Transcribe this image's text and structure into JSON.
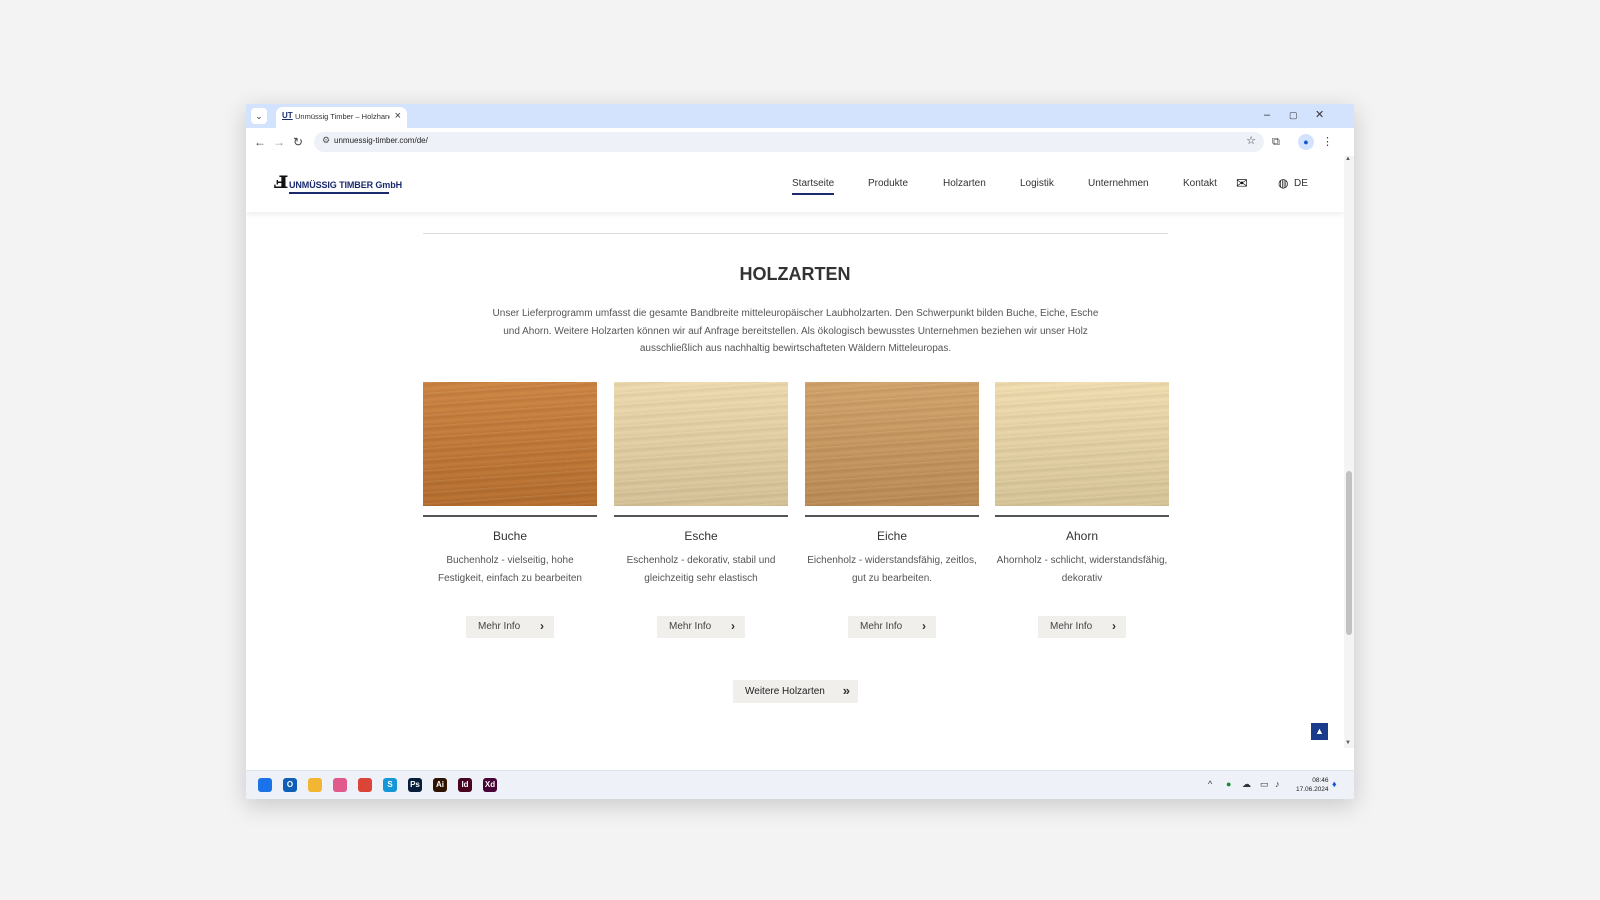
{
  "browser": {
    "tab_title": "Unmüssig Timber – Holzhandel",
    "tab_favicon": "UT",
    "url": "unmuessig-timber.com/de/",
    "tab_dropdown_icon": "chevron-down-icon",
    "window_controls": [
      "–",
      "▢",
      "✕"
    ]
  },
  "site": {
    "logo_text": "UNMÜSSIG TIMBER GmbH",
    "nav": [
      {
        "label": "Startseite",
        "active": true
      },
      {
        "label": "Produkte",
        "active": false
      },
      {
        "label": "Holzarten",
        "active": false
      },
      {
        "label": "Logistik",
        "active": false
      },
      {
        "label": "Unternehmen",
        "active": false
      },
      {
        "label": "Kontakt",
        "active": false
      }
    ],
    "language": "DE"
  },
  "section": {
    "title": "HOLZARTEN",
    "intro": "Unser Lieferprogramm umfasst die gesamte Bandbreite mitteleuropäischer Laubholzarten. Den Schwerpunkt bilden Buche, Eiche, Esche und Ahorn. Weitere Holzarten können wir auf Anfrage bereitstellen. Als ökologisch bewusstes Unternehmen beziehen wir unser Holz ausschließlich aus nachhaltig bewirtschafteten Wäldern Mitteleuropas.",
    "cards": [
      {
        "title": "Buche",
        "desc": "Buchenholz - vielseitig, hohe Festigkeit, einfach zu bearbeiten",
        "button": "Mehr Info",
        "color": "#c9782f"
      },
      {
        "title": "Esche",
        "desc": "Eschenholz - dekorativ, stabil und gleichzeitig sehr elastisch",
        "button": "Mehr Info",
        "color": "#eed8a8"
      },
      {
        "title": "Eiche",
        "desc": "Eichenholz - widerstandsfähig, zeitlos, gut zu bearbeiten.",
        "button": "Mehr Info",
        "color": "#cf9a5c"
      },
      {
        "title": "Ahorn",
        "desc": "Ahornholz - schlicht, widerstandsfähig, dekorativ",
        "button": "Mehr Info",
        "color": "#f1dca9"
      }
    ],
    "more_button": "Weitere Holzarten"
  },
  "taskbar": {
    "apps": [
      {
        "name": "windows-start",
        "glyph": "",
        "color": "#1a73e8"
      },
      {
        "name": "outlook",
        "glyph": "O",
        "color": "#0f5fb8"
      },
      {
        "name": "file-explorer",
        "glyph": "",
        "color": "#f2b632"
      },
      {
        "name": "photos",
        "glyph": "",
        "color": "#e25a8b"
      },
      {
        "name": "chrome",
        "glyph": "",
        "color": "#db4437"
      },
      {
        "name": "skype",
        "glyph": "S",
        "color": "#1497d7"
      },
      {
        "name": "photoshop",
        "glyph": "Ps",
        "color": "#061e3c"
      },
      {
        "name": "illustrator",
        "glyph": "Ai",
        "color": "#2e1300"
      },
      {
        "name": "indesign",
        "glyph": "Id",
        "color": "#49021f"
      },
      {
        "name": "xd",
        "glyph": "Xd",
        "color": "#470137"
      }
    ],
    "time": "08:46",
    "date": "17.06.2024"
  }
}
